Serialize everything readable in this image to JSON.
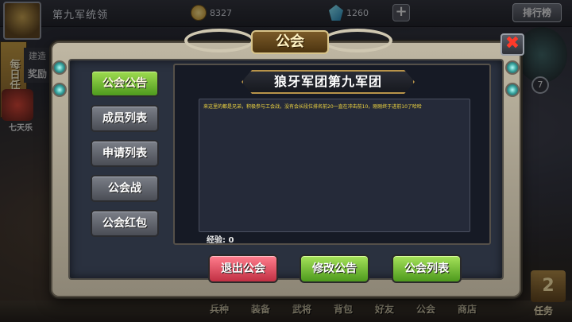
{
  "hud": {
    "player_name": "第九军统领",
    "gold": "8327",
    "gems": "1260",
    "add_symbol": "+",
    "rank_button": "排行榜",
    "daily_task": "每日任务",
    "side_label_a": "建造",
    "side_label_b": "奖励",
    "seven_day": "七天乐",
    "level": "7"
  },
  "bottom_nav": {
    "items": [
      "兵种",
      "装备",
      "武将",
      "背包",
      "好友",
      "公会",
      "商店"
    ],
    "task": "任务",
    "task_book_glyph": "2"
  },
  "dialog": {
    "title": "公会",
    "close_glyph": "✖",
    "menu": [
      {
        "label": "公会公告",
        "active": true
      },
      {
        "label": "成员列表",
        "active": false
      },
      {
        "label": "申请列表",
        "active": false
      },
      {
        "label": "公会战",
        "active": false
      },
      {
        "label": "公会红包",
        "active": false
      }
    ],
    "guild_name": "狼牙军团第九军团",
    "announcement": "来这里的都是兄弟，积极参与工会战，没有会长段位排名前20一直在冲击前10，刚刚终于进前10了哈哈",
    "exp_label": "经验: 0",
    "buttons": {
      "leave": "退出公会",
      "edit": "修改公告",
      "list": "公会列表"
    }
  },
  "colors": {
    "active_green": "#7fc43a",
    "leave_red": "#e0485c",
    "announce_yellow": "#f0d640"
  }
}
